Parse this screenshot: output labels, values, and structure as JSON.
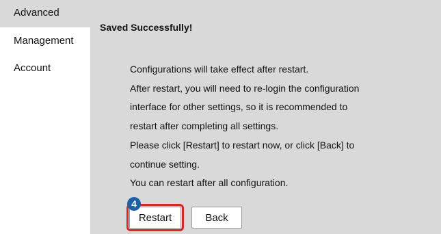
{
  "sidebar": {
    "items": [
      {
        "label": "Advanced"
      },
      {
        "label": "Management"
      },
      {
        "label": "Account"
      }
    ]
  },
  "main": {
    "saved_title": "Saved Successfully!",
    "message_lines": [
      "Configurations will take effect after restart.",
      "After restart, you will need to re-login the configuration",
      "interface for other settings, so it is recommended to",
      "restart after completing all settings.",
      "Please click [Restart] to restart now, or click [Back] to",
      "continue setting.",
      "You can restart after all configuration."
    ],
    "restart_label": "Restart",
    "back_label": "Back",
    "step_badge": "4"
  },
  "colors": {
    "panel_background": "#d9d9d9",
    "highlight_border": "#d9252a",
    "badge": "#1f5fa8"
  }
}
